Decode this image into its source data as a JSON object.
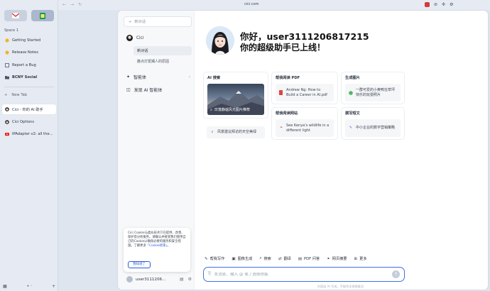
{
  "browser": {
    "url": "cici.com",
    "space_label": "Space 1",
    "bookmarks": [
      {
        "label": "Getting Started",
        "icon": "start-icon"
      },
      {
        "label": "Release Notes",
        "icon": "notes-icon"
      },
      {
        "label": "Report a Bug",
        "icon": "bug-icon"
      },
      {
        "label": "BCNY Social",
        "icon": "folder-icon"
      }
    ],
    "new_tab_label": "New Tab",
    "tabs": [
      {
        "label": "Cici - 你的 AI 助手",
        "active": true
      },
      {
        "label": "Cici Options",
        "active": false
      },
      {
        "label": "IPAdapter v2: all the...",
        "active": false
      }
    ]
  },
  "sidebar": {
    "new_chat": "新对话",
    "agent_name": "Cici",
    "sub_active": "新对话",
    "sub_item": "撒点打斑斓人的原因",
    "menu": [
      {
        "label": "智能体",
        "has_chevron": true
      },
      {
        "label": "发现 AI 智能体",
        "has_chevron": false
      }
    ],
    "cookie": {
      "text": "Cici Cookie与类似技术只在提供、改善、保护及分析服务。请确认并接受我们使用自己的Cookie以确保必要的服务和安全措施。了解更多",
      "link": "「Cookie政策」",
      "tail": "。",
      "button": "我知道了"
    },
    "user_name": "user3111206..."
  },
  "hero": {
    "title": "你好，user3111206817215",
    "subtitle": "你的超级助手已上线！"
  },
  "cards": [
    {
      "title": "AI 搜索",
      "image_caption": "日落静谧风光图片推荐",
      "item": "风景建议拜访的天空美绿"
    },
    {
      "title": "帮我阅读 PDF",
      "item": "Andrew Ng: How to Build a Career in AI.pdf"
    },
    {
      "title": "生成图片",
      "item": "一群可爱的小黄鸭在草坪快乐的玩耍照片"
    },
    {
      "title": "帮我阅读网站",
      "item": "See Kenya's wildlife in a different light"
    },
    {
      "title": "撰写短文",
      "item": "中小企业的数字营销策略"
    }
  ],
  "tools": [
    "帮我写作",
    "图像生成",
    "搜索",
    "翻译",
    "PDF 问答",
    "网页摘要",
    "更多"
  ],
  "input": {
    "placeholder": "发消息、输入 @ 或 / 选择技能"
  },
  "footnote": "内容由 AI 生成，不能完全保障真实"
}
